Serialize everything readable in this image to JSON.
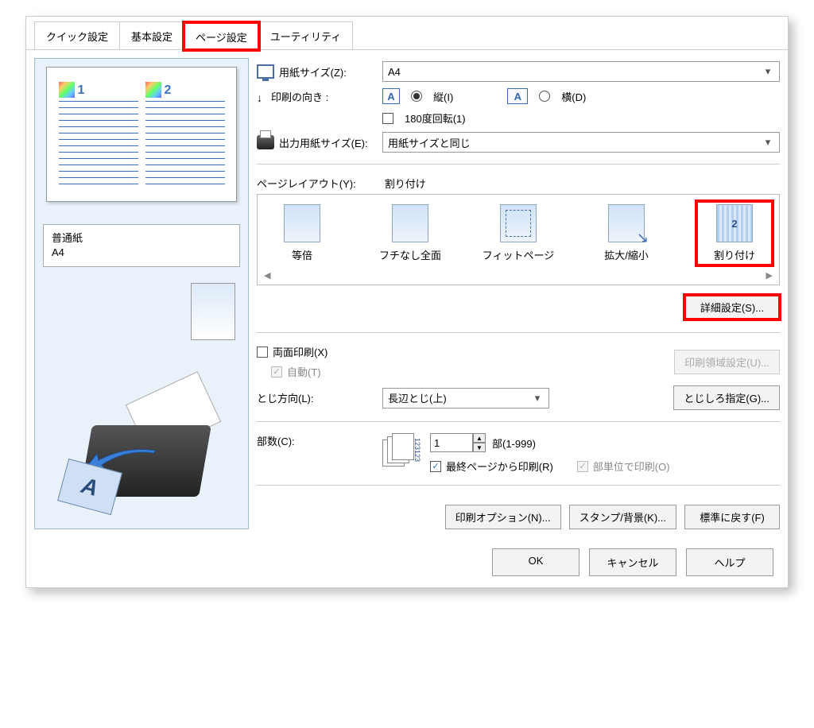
{
  "tabs": {
    "quick": "クイック設定",
    "basic": "基本設定",
    "page": "ページ設定",
    "utility": "ユーティリティ"
  },
  "preview": {
    "paper_type": "普通紙",
    "paper_size": "A4",
    "page1": "1",
    "page2": "2"
  },
  "settings": {
    "paper_size_label": "用紙サイズ(Z):",
    "paper_size_value": "A4",
    "orientation_label": "印刷の向き :",
    "portrait": "縦(I)",
    "landscape": "横(D)",
    "rotate180": "180度回転(1)",
    "output_size_label": "出力用紙サイズ(E):",
    "output_size_value": "用紙サイズと同じ",
    "page_layout_label": "ページレイアウト(Y):",
    "page_layout_value": "割り付け",
    "layout_options": {
      "normal": "等倍",
      "borderless": "フチなし全面",
      "fit": "フィットページ",
      "scaled": "拡大/縮小",
      "nup": "割り付け",
      "nup_num": "2"
    },
    "detail_button": "詳細設定(S)...",
    "duplex": "両面印刷(X)",
    "auto": "自動(T)",
    "print_area_button": "印刷領域設定(U)...",
    "bind_dir_label": "とじ方向(L):",
    "bind_dir_value": "長辺とじ(上)",
    "bind_margin_button": "とじしろ指定(G)...",
    "copies_label": "部数(C):",
    "copies_value": "1",
    "copies_range": "部(1-999)",
    "reverse_order": "最終ページから印刷(R)",
    "collate": "部単位で印刷(O)",
    "copies_nums": "123123"
  },
  "bottom_buttons": {
    "print_options": "印刷オプション(N)...",
    "stamp_bg": "スタンプ/背景(K)...",
    "defaults": "標準に戻す(F)"
  },
  "dialog": {
    "ok": "OK",
    "cancel": "キャンセル",
    "help": "ヘルプ"
  }
}
